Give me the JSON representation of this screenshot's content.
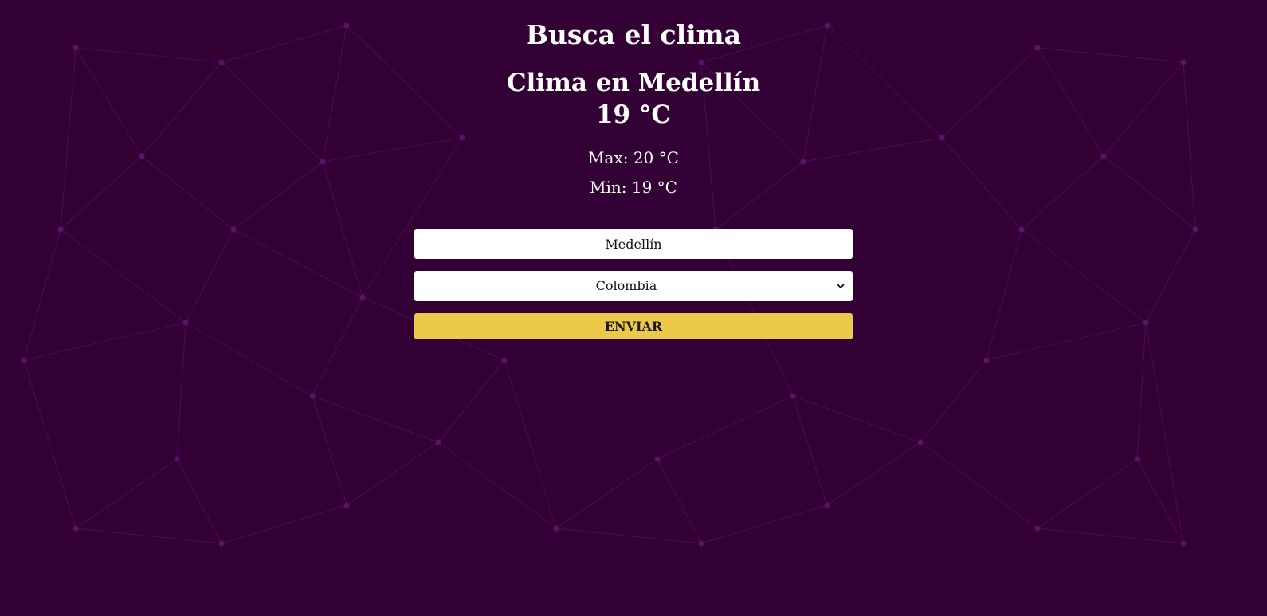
{
  "page": {
    "title": "Busca el clima",
    "background_color": "#320034",
    "accent_color": "#ecc84b"
  },
  "result": {
    "city_heading": "Clima en Medellín",
    "temperature": "19 °C",
    "max": "Max: 20 °C",
    "min": "Min: 19 °C"
  },
  "form": {
    "city_value": "Medellín",
    "country_selected": "Colombia",
    "submit_label": "ENVIAR",
    "dropdown_icon": "chevron-down-icon"
  }
}
